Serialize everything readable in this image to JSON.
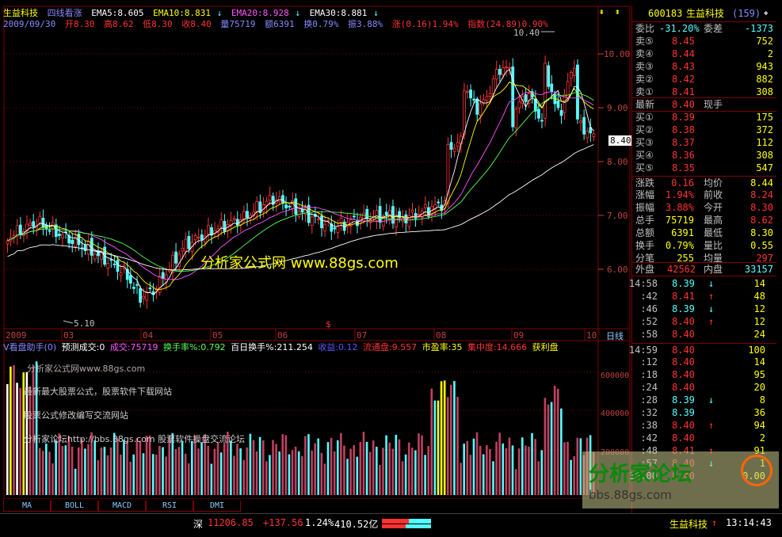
{
  "header": {
    "stock_name": "生益科技",
    "indicator_name": "四线看涨",
    "ema5": "EMA5:8.605",
    "ema10": "EMA10:8.831",
    "ema20": "EMA20:8.928",
    "ema30": "EMA30:8.881",
    "arrow": "↓",
    "date": "2009/09/30",
    "open": "开8.30",
    "high": "高8.62",
    "low": "低8.30",
    "close": "收8.40",
    "volume": "量75719",
    "amount": "额6391",
    "turnover": "换0.79%",
    "amplitude": "振3.88%",
    "change": "涨(0.16)1.94%",
    "index": "指数(24.89)0.90%"
  },
  "price_axis": {
    "labels": [
      "10.00",
      "9.00",
      "8.00",
      "7.00",
      "6.00"
    ],
    "current_price": "8.40",
    "peak_label": "10.40",
    "low_label": "5.10"
  },
  "time_axis": {
    "labels": [
      "2009",
      "03",
      "04",
      "05",
      "06",
      "07",
      "08",
      "09",
      "10"
    ],
    "period_label": "日线"
  },
  "volume_header": {
    "name": "V看盘助手(0)",
    "pred": "预测成交:0",
    "vol": "成交:75719",
    "turn": "换手率%:0.792",
    "hundred": "百日换手%:211.254",
    "recover": "收益:0.12",
    "float": "流通盘:9.557",
    "pe": "市盈率:35",
    "concentration": "集中度:14.666",
    "profit": "获利盘"
  },
  "volume_axis": {
    "labels": [
      "600000",
      "400000",
      "200000"
    ]
  },
  "watermarks": {
    "center": "分析家公式网  www.88gs.com",
    "l1": "分析家公式网www.88gs.com",
    "l2": "最新最大股票公式，股票软件下载网站",
    "l3": "股票公式修改编写交流网站",
    "l4": "分析家论坛http://bbs.88gs.com 股票软件操盘交流论坛",
    "logo": "分析家论坛",
    "logo_url": "bbs.88gs.com"
  },
  "tabs": [
    "MA",
    "BOLL",
    "MACD",
    "RSI",
    "DMI"
  ],
  "quote": {
    "code": "600183",
    "name": "生益科技",
    "seq": "(159)",
    "weibi_label": "委比",
    "weibi": "-31.20%",
    "weicha_label": "委差",
    "weicha": "-1373",
    "asks": [
      {
        "label": "卖⑤",
        "price": "8.45",
        "vol": "752"
      },
      {
        "label": "卖④",
        "price": "8.44",
        "vol": "2"
      },
      {
        "label": "卖③",
        "price": "8.43",
        "vol": "943"
      },
      {
        "label": "卖②",
        "price": "8.42",
        "vol": "882"
      },
      {
        "label": "卖①",
        "price": "8.41",
        "vol": "308"
      }
    ],
    "latest_label": "最新",
    "latest": "8.40",
    "latest_vol_label": "现手",
    "bids": [
      {
        "label": "买①",
        "price": "8.39",
        "vol": "175"
      },
      {
        "label": "买②",
        "price": "8.38",
        "vol": "372"
      },
      {
        "label": "买③",
        "price": "8.37",
        "vol": "112"
      },
      {
        "label": "买④",
        "price": "8.36",
        "vol": "308"
      },
      {
        "label": "买⑤",
        "price": "8.35",
        "vol": "547"
      }
    ],
    "stats": [
      {
        "l1": "涨跌",
        "v1": "0.16",
        "l2": "均价",
        "v2": "8.44"
      },
      {
        "l1": "涨幅",
        "v1": "1.94%",
        "l2": "前收",
        "v2": "8.24"
      },
      {
        "l1": "振幅",
        "v1": "3.88%",
        "l2": "今开",
        "v2": "8.30"
      },
      {
        "l1": "总手",
        "v1": "75719",
        "l2": "最高",
        "v2": "8.62"
      },
      {
        "l1": "总额",
        "v1": "6391",
        "l2": "最低",
        "v2": "8.30"
      },
      {
        "l1": "换手",
        "v1": "0.79%",
        "l2": "量比",
        "v2": "0.55"
      },
      {
        "l1": "分笔",
        "v1": "255",
        "l2": "均量",
        "v2": "297"
      }
    ],
    "outer_label": "外盘",
    "outer": "42562",
    "inner_label": "内盘",
    "inner": "33157"
  },
  "ticks": [
    {
      "t": "14:58",
      "p": "8.39",
      "v": "14",
      "a": "↓"
    },
    {
      "t": ":42",
      "p": "8.41",
      "v": "48",
      "a": "↑"
    },
    {
      "t": ":46",
      "p": "8.39",
      "v": "12",
      "a": "↓"
    },
    {
      "t": ":52",
      "p": "8.40",
      "v": "12",
      "a": "↑"
    },
    {
      "t": ":58",
      "p": "8.40",
      "v": "24",
      "a": ""
    },
    {
      "t": "14:59",
      "p": "8.40",
      "v": "100",
      "a": ""
    },
    {
      "t": ":12",
      "p": "8.40",
      "v": "14",
      "a": ""
    },
    {
      "t": ":18",
      "p": "8.40",
      "v": "95",
      "a": ""
    },
    {
      "t": ":24",
      "p": "8.40",
      "v": "20",
      "a": ""
    },
    {
      "t": ":28",
      "p": "8.39",
      "v": "8",
      "a": "↓"
    },
    {
      "t": ":32",
      "p": "8.39",
      "v": "36",
      "a": ""
    },
    {
      "t": ":38",
      "p": "8.40",
      "v": "94",
      "a": "↑"
    },
    {
      "t": ":42",
      "p": "8.40",
      "v": "2",
      "a": ""
    },
    {
      "t": ":48",
      "p": "8.41",
      "v": "91",
      "a": "↑"
    },
    {
      "t": ":57",
      "p": "8.40",
      "v": "1",
      "a": "↓"
    },
    {
      "t": "15:00",
      "p": "8.40",
      "v": "0.00",
      "a": ""
    }
  ],
  "status": {
    "market": "深",
    "index": "11206.85",
    "change": "+137.56",
    "pct": "1.24%",
    "amount": "410.52亿",
    "stock": "生益科技",
    "time": "13:14:43"
  },
  "colors": {
    "up": "#ff3232",
    "down": "#54ffff",
    "yellow": "#ffff00",
    "label": "#c0c0c0"
  }
}
